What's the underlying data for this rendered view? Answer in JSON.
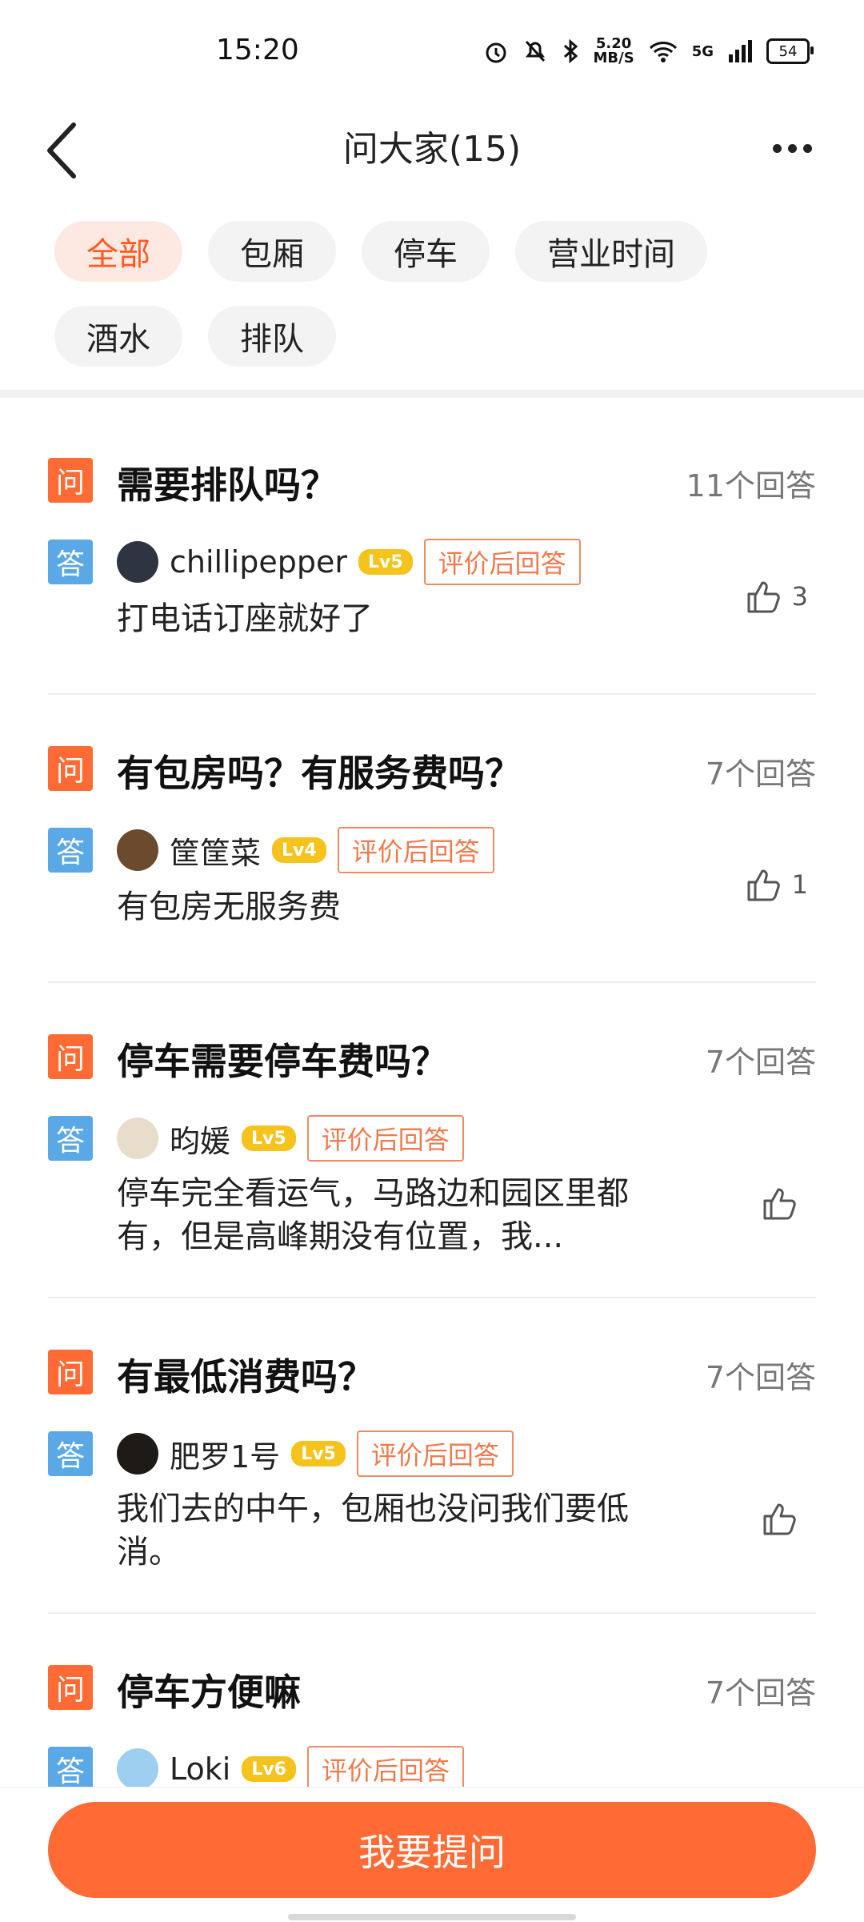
{
  "status_bar": {
    "time": "15:20",
    "speed_value": "5.20",
    "speed_unit": "MB/S",
    "network": "5G",
    "battery": "54",
    "icons": [
      "alarm-icon",
      "bell-mute-icon",
      "bluetooth-icon",
      "wifi-icon",
      "signal-icon",
      "battery-icon"
    ]
  },
  "header": {
    "title": "问大家(15)",
    "back_icon": "chevron-left-icon",
    "more_icon": "more-dots-icon"
  },
  "filters": [
    {
      "label": "全部",
      "active": true
    },
    {
      "label": "包厢",
      "active": false
    },
    {
      "label": "停车",
      "active": false
    },
    {
      "label": "营业时间",
      "active": false
    },
    {
      "label": "酒水",
      "active": false
    },
    {
      "label": "排队",
      "active": false
    }
  ],
  "qa_items": [
    {
      "q_tag": "问",
      "a_tag": "答",
      "question": "需要排队吗？",
      "answer_count": "11个回答",
      "user": "chillipepper",
      "level": "Lv5",
      "review_label": "评价后回答",
      "answer": "打电话订座就好了",
      "likes": "3"
    },
    {
      "q_tag": "问",
      "a_tag": "答",
      "question": "有包房吗？有服务费吗？",
      "answer_count": "7个回答",
      "user": "筐筐菜",
      "level": "Lv4",
      "review_label": "评价后回答",
      "answer": "有包房无服务费",
      "likes": "1"
    },
    {
      "q_tag": "问",
      "a_tag": "答",
      "question": "停车需要停车费吗？",
      "answer_count": "7个回答",
      "user": "昀媛",
      "level": "Lv5",
      "review_label": "评价后回答",
      "answer": "停车完全看运气，马路边和园区里都有，但是高峰期没有位置，我...",
      "likes": ""
    },
    {
      "q_tag": "问",
      "a_tag": "答",
      "question": "有最低消费吗？",
      "answer_count": "7个回答",
      "user": "肥罗1号",
      "level": "Lv5",
      "review_label": "评价后回答",
      "answer": "我们去的中午，包厢也没问我们要低消。",
      "likes": ""
    },
    {
      "q_tag": "问",
      "a_tag": "答",
      "question": "停车方便嘛",
      "answer_count": "7个回答",
      "user": "Loki",
      "level": "Lv6",
      "review_label": "评价后回答",
      "answer": "",
      "likes": ""
    }
  ],
  "bottom": {
    "ask_button": "我要提问"
  },
  "colors": {
    "accent": "#ff6a35",
    "question_tag": "#ff6a35",
    "answer_tag": "#5aa9e6",
    "level_badge": "#f6c21c",
    "active_chip_bg": "#fde9e2"
  }
}
